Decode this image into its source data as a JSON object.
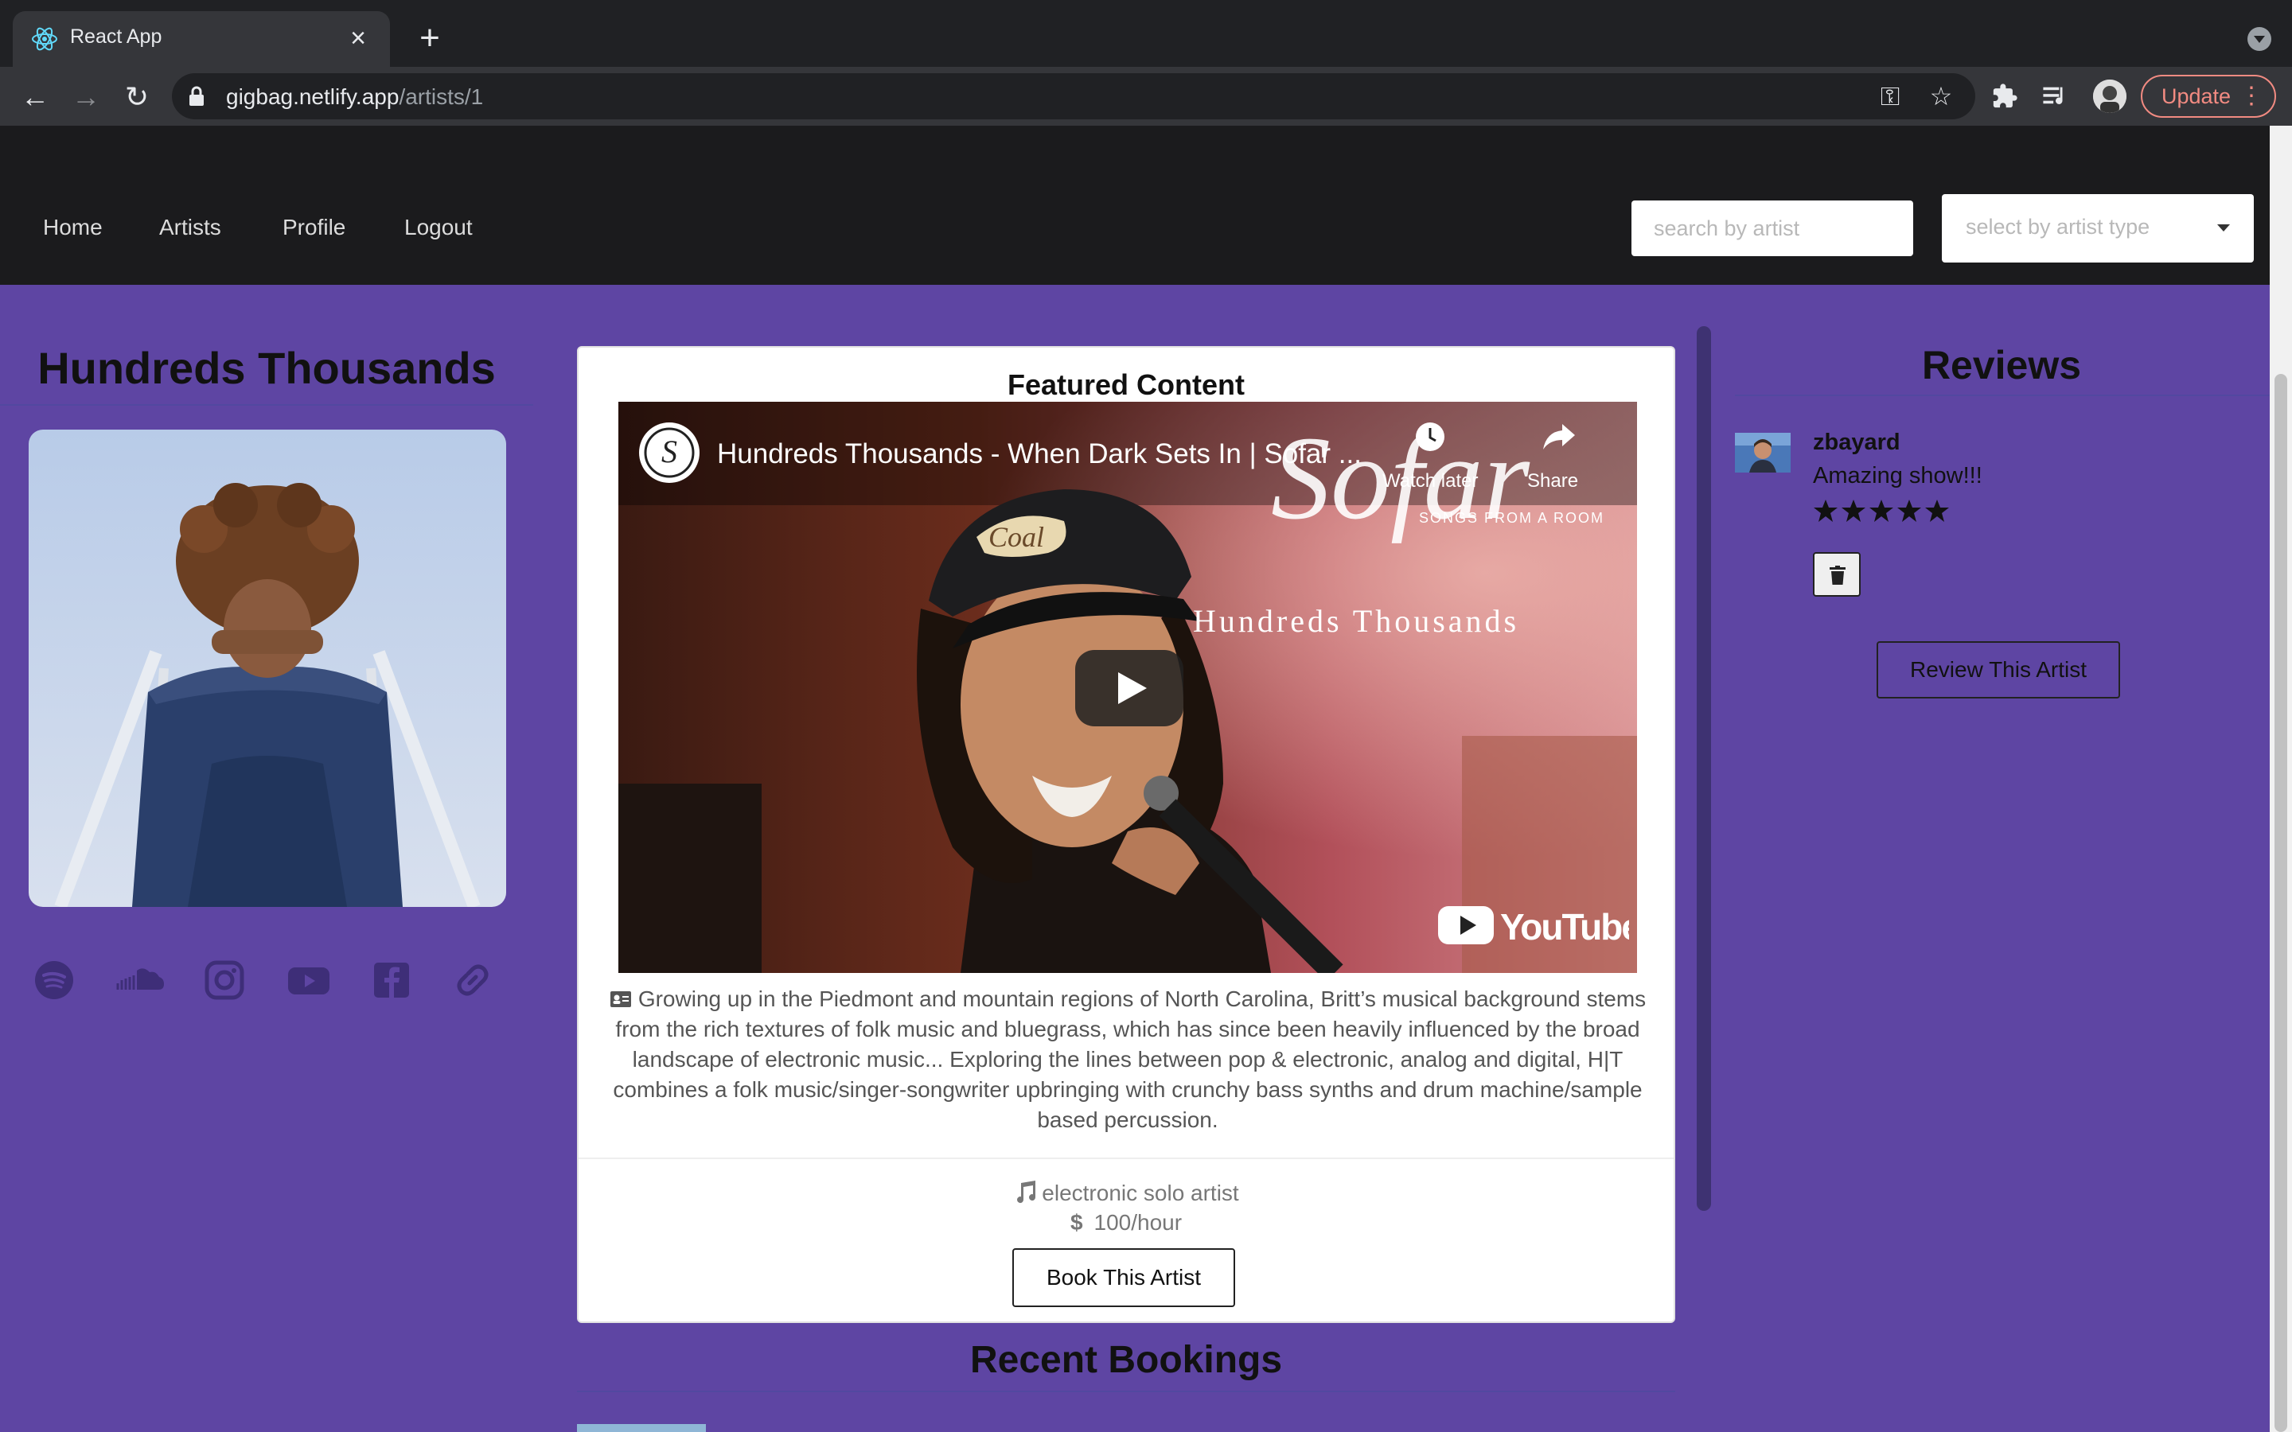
{
  "browser": {
    "tab_title": "React App",
    "url_host": "gigbag.netlify.app",
    "url_path": "/artists/1",
    "update_label": "Update"
  },
  "nav": {
    "links": [
      "Home",
      "Artists",
      "Profile",
      "Logout"
    ],
    "search_placeholder": "search by artist",
    "select_placeholder": "select by artist type"
  },
  "artist": {
    "name": "Hundreds Thousands",
    "social_icons": [
      "spotify-icon",
      "soundcloud-icon",
      "instagram-icon",
      "youtube-icon",
      "facebook-icon",
      "link-icon"
    ]
  },
  "featured": {
    "title": "Featured Content",
    "video_title": "Hundreds Thousands - When Dark Sets In | Sofar ...",
    "watch_later": "Watch later",
    "share": "Share",
    "overlay_brand": "Sofar",
    "overlay_brand_sub": "SONGS FROM A ROOM",
    "overlay_band": "Hundreds Thousands",
    "bio": "Growing up in the Piedmont and mountain regions of North Carolina, Britt’s musical background stems from the rich textures of folk music and bluegrass, which has since been heavily influenced by the broad landscape of electronic music... Exploring the lines between pop & electronic, analog and digital, H|T combines a folk music/singer-songwriter upbringing with crunchy bass synths and drum machine/sample based percussion.",
    "artist_type": "electronic solo artist",
    "rate": "100/hour",
    "book_label": "Book This Artist"
  },
  "recent": {
    "title": "Recent Bookings"
  },
  "reviews": {
    "title": "Reviews",
    "items": [
      {
        "user": "zbayard",
        "text": "Amazing show!!!",
        "rating": 5
      }
    ],
    "review_label": "Review This Artist"
  },
  "colors": {
    "page_bg": "#5e45a3",
    "nav_bg": "#1b1b1d",
    "update_accent": "#f28b82"
  }
}
